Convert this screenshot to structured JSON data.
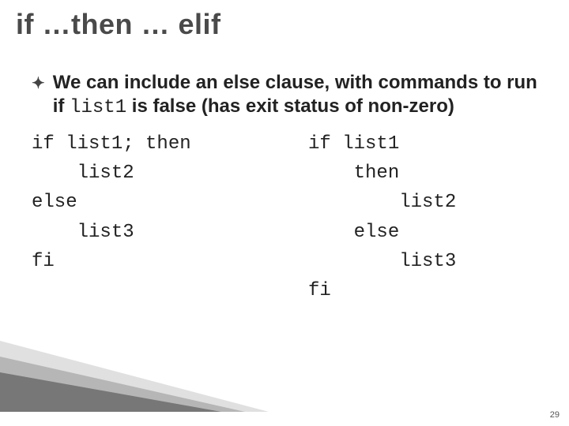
{
  "slide": {
    "title": "if …then … elif",
    "bullet": "We can include an else clause, with commands to run if ",
    "bullet_code": "list1",
    "bullet_tail": " is false (has exit status of non-zero)",
    "code_left": "if list1; then\n    list2\nelse\n    list3\nfi",
    "code_right": "if list1\n    then\n        list2\n    else\n        list3\nfi",
    "page_number": "29"
  }
}
